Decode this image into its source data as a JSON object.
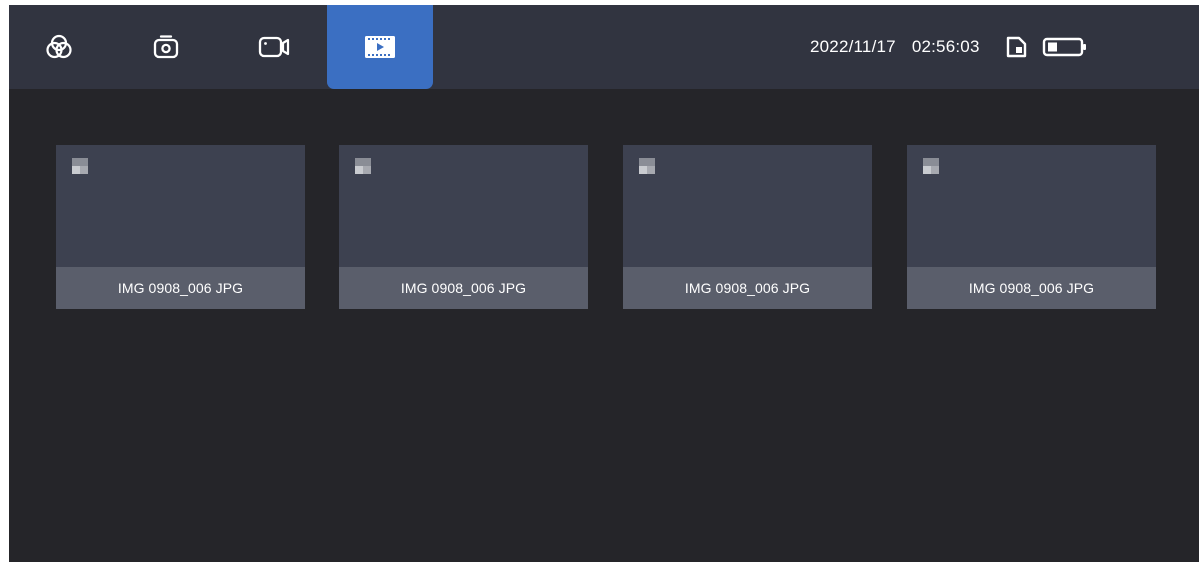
{
  "tabs": [
    {
      "name": "filter",
      "icon": "color-filter-icon",
      "active": false
    },
    {
      "name": "photo",
      "icon": "camera-icon",
      "active": false
    },
    {
      "name": "video",
      "icon": "video-camera-icon",
      "active": false
    },
    {
      "name": "playback",
      "icon": "playback-icon",
      "active": true
    }
  ],
  "status": {
    "date": "2022/11/17",
    "time": "02:56:03",
    "storage_icon": "sd-card-icon",
    "battery_icon": "battery-icon"
  },
  "gallery": {
    "items": [
      {
        "filename": "IMG 0908_006 JPG",
        "icon": "image-placeholder-icon"
      },
      {
        "filename": "IMG 0908_006 JPG",
        "icon": "image-placeholder-icon"
      },
      {
        "filename": "IMG 0908_006 JPG",
        "icon": "image-placeholder-icon"
      },
      {
        "filename": "IMG 0908_006 JPG",
        "icon": "image-placeholder-icon"
      }
    ]
  },
  "colors": {
    "background": "#252529",
    "topbar": "#313440",
    "accent": "#3b6fc2",
    "thumbnail": "#3d4150",
    "caption": "#5a5e6b"
  }
}
